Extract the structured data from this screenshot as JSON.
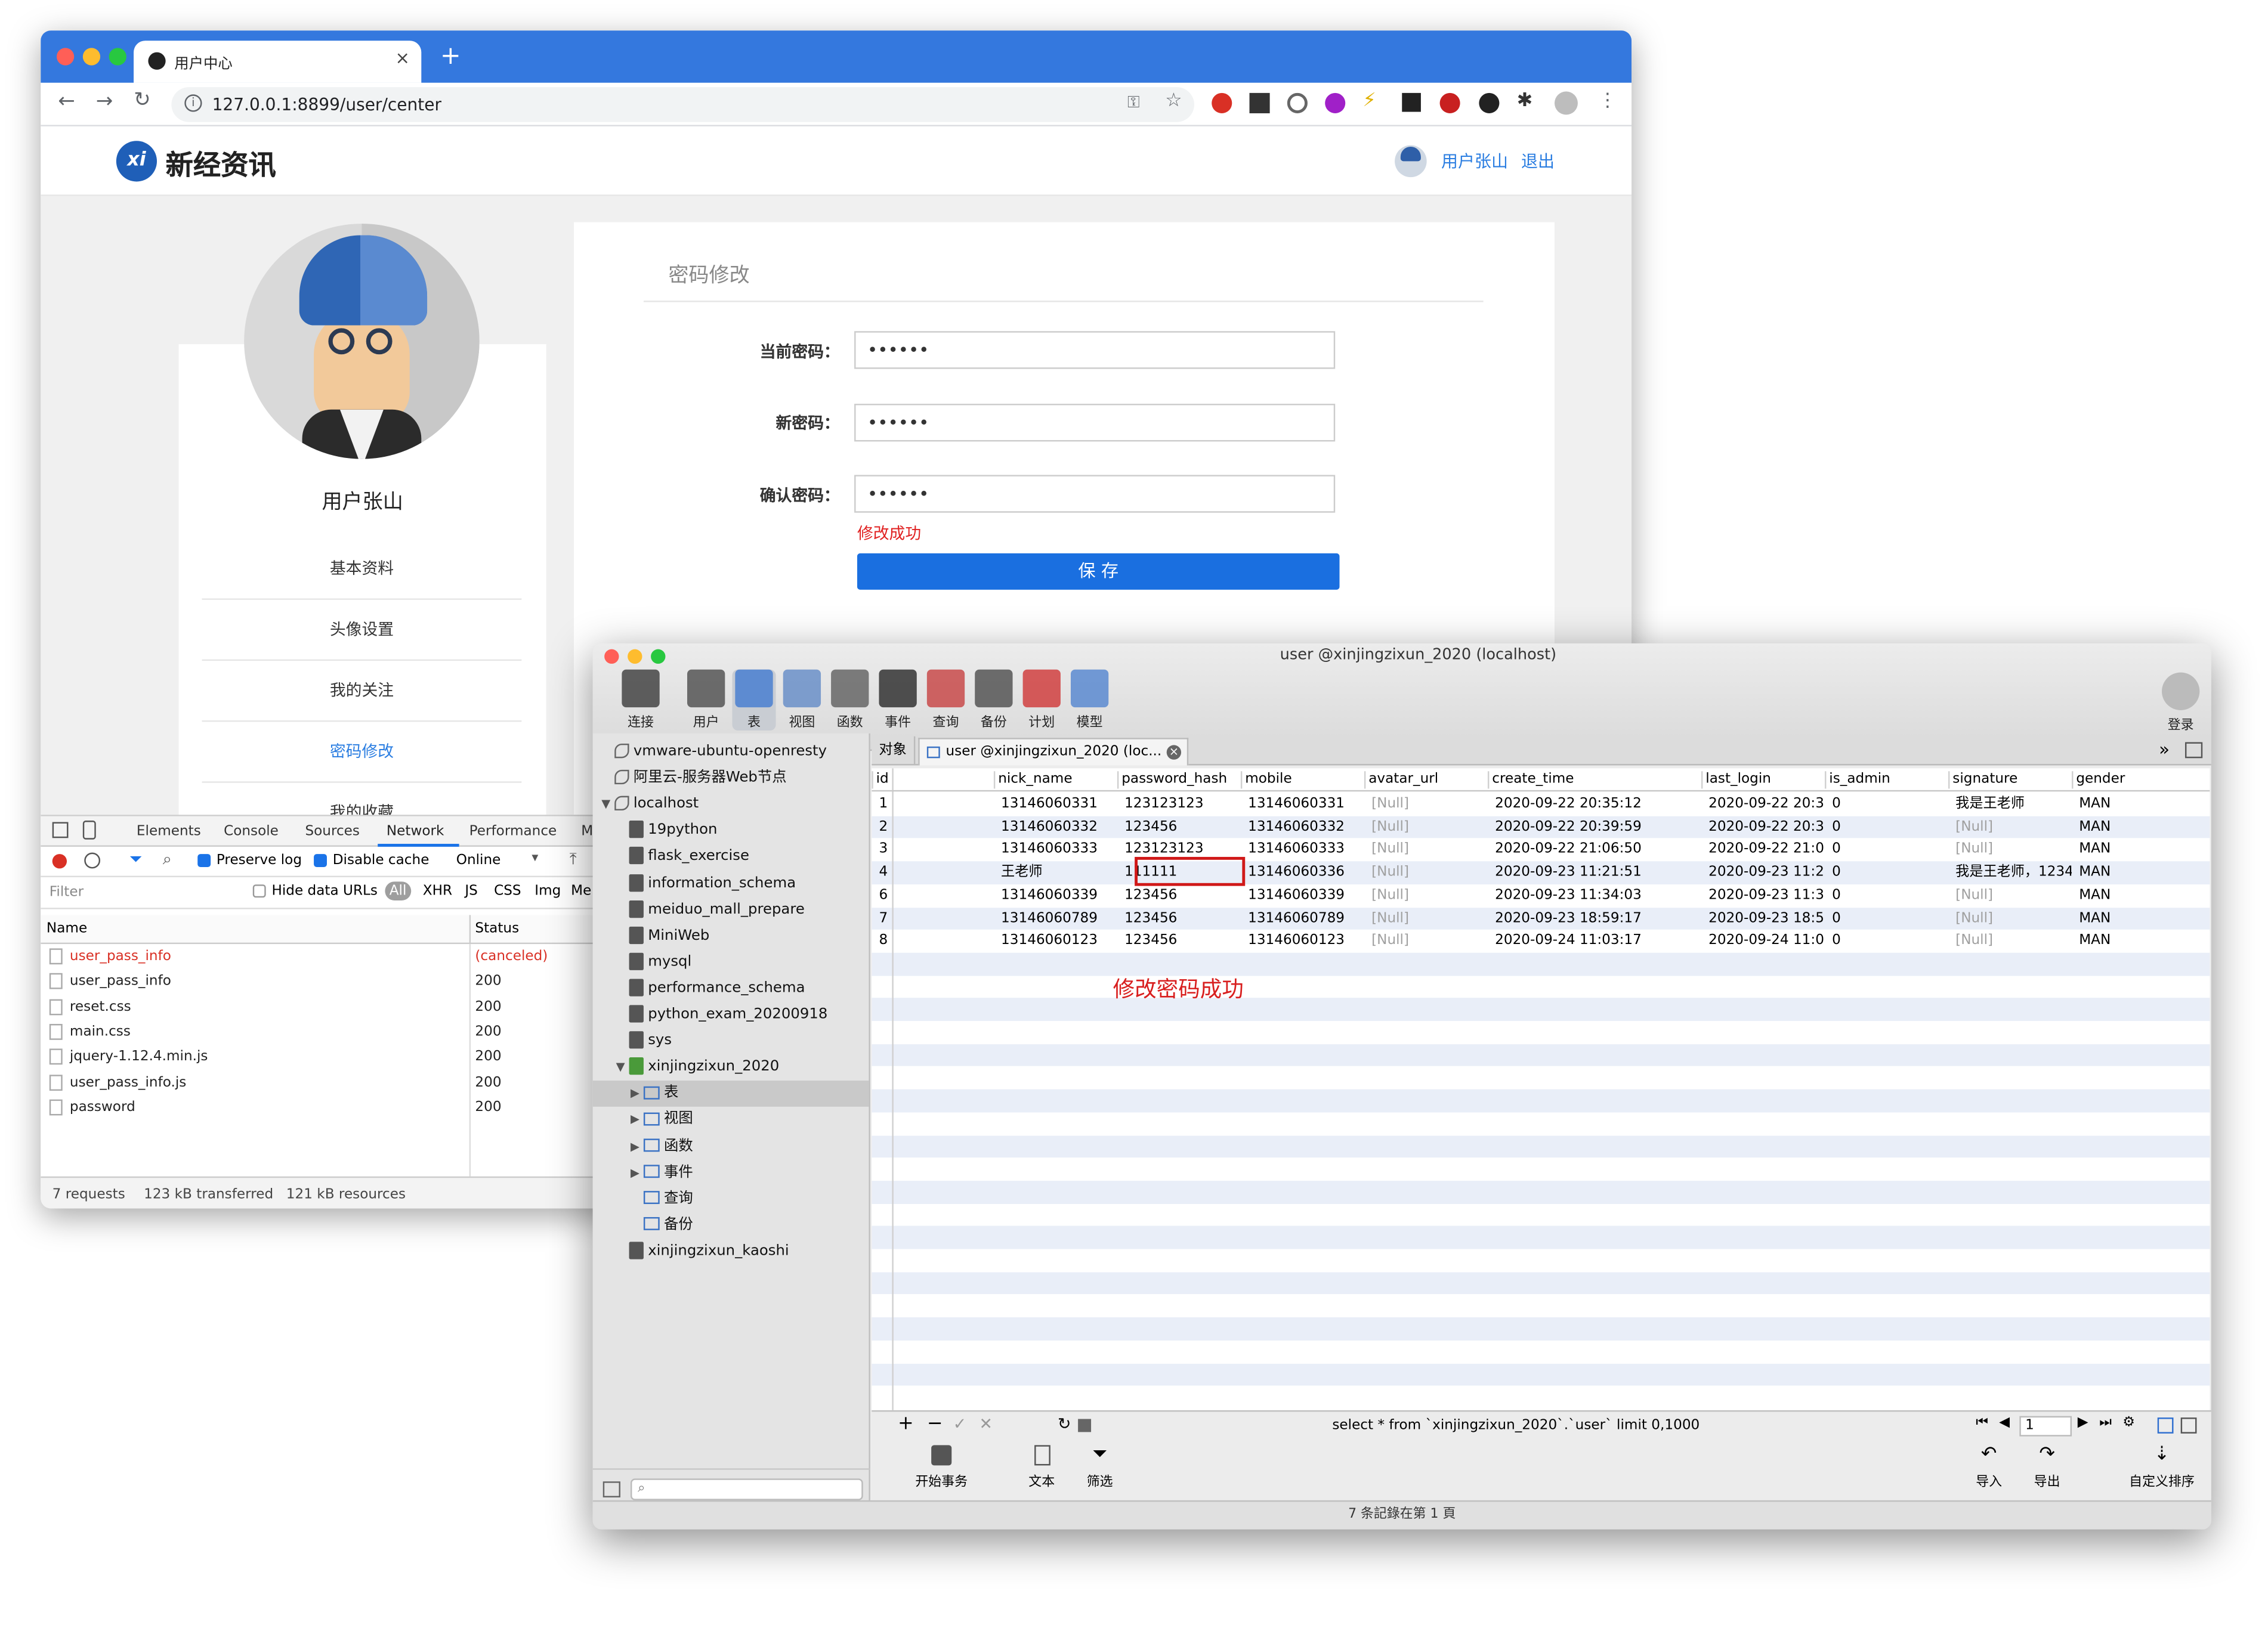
{
  "browser": {
    "tab_title": "用户中心",
    "url": "127.0.0.1:8899/user/center"
  },
  "site": {
    "logo_text": "新经资讯",
    "user_name": "用户张山",
    "logout": "退出",
    "sidebar_name": "用户张山",
    "menu": [
      "基本资料",
      "头像设置",
      "我的关注",
      "密码修改",
      "我的收藏"
    ],
    "active_menu_index": 3,
    "form_title": "密码修改",
    "labels": {
      "current": "当前密码：",
      "new": "新密码：",
      "confirm": "确认密码："
    },
    "values": {
      "current": "••••••",
      "new": "••••••",
      "confirm": "••••••"
    },
    "success_msg": "修改成功",
    "save_button": "保 存"
  },
  "devtools": {
    "tabs": [
      "Elements",
      "Console",
      "Sources",
      "Network",
      "Performance",
      "M"
    ],
    "active_tab": "Network",
    "preserve_log": "Preserve log",
    "disable_cache": "Disable cache",
    "throttle": "Online",
    "filter_placeholder": "Filter",
    "hide_data_urls": "Hide data URLs",
    "types": [
      "All",
      "XHR",
      "JS",
      "CSS",
      "Img",
      "Me"
    ],
    "col_name": "Name",
    "col_status": "Status",
    "requests": [
      {
        "name": "user_pass_info",
        "status": "(canceled)",
        "error": true
      },
      {
        "name": "user_pass_info",
        "status": "200",
        "error": false
      },
      {
        "name": "reset.css",
        "status": "200",
        "error": false
      },
      {
        "name": "main.css",
        "status": "200",
        "error": false
      },
      {
        "name": "jquery-1.12.4.min.js",
        "status": "200",
        "error": false
      },
      {
        "name": "user_pass_info.js",
        "status": "200",
        "error": false
      },
      {
        "name": "password",
        "status": "200",
        "error": false
      }
    ],
    "summary": [
      "7 requests",
      "123 kB transferred",
      "121 kB resources"
    ]
  },
  "navicat": {
    "title": "user @xinjingzixun_2020 (localhost)",
    "toolbar": [
      "连接",
      "用户",
      "表",
      "视图",
      "函数",
      "事件",
      "查询",
      "备份",
      "计划",
      "模型"
    ],
    "login": "登录",
    "sidebar": [
      {
        "label": "vmware-ubuntu-openresty",
        "level": 0,
        "type": "conn"
      },
      {
        "label": "阿里云-服务器Web节点",
        "level": 0,
        "type": "conn"
      },
      {
        "label": "localhost",
        "level": 0,
        "type": "conn-open"
      },
      {
        "label": "19python",
        "level": 1,
        "type": "db"
      },
      {
        "label": "flask_exercise",
        "level": 1,
        "type": "db"
      },
      {
        "label": "information_schema",
        "level": 1,
        "type": "db"
      },
      {
        "label": "meiduo_mall_prepare",
        "level": 1,
        "type": "db"
      },
      {
        "label": "MiniWeb",
        "level": 1,
        "type": "db"
      },
      {
        "label": "mysql",
        "level": 1,
        "type": "db"
      },
      {
        "label": "performance_schema",
        "level": 1,
        "type": "db"
      },
      {
        "label": "python_exam_20200918",
        "level": 1,
        "type": "db"
      },
      {
        "label": "sys",
        "level": 1,
        "type": "db"
      },
      {
        "label": "xinjingzixun_2020",
        "level": 1,
        "type": "db-open"
      },
      {
        "label": "表",
        "level": 2,
        "type": "folder-sel"
      },
      {
        "label": "视图",
        "level": 2,
        "type": "folder"
      },
      {
        "label": "函数",
        "level": 2,
        "type": "folder"
      },
      {
        "label": "事件",
        "level": 2,
        "type": "folder"
      },
      {
        "label": "查询",
        "level": 2,
        "type": "leaf"
      },
      {
        "label": "备份",
        "level": 2,
        "type": "leaf"
      },
      {
        "label": "xinjingzixun_kaoshi",
        "level": 1,
        "type": "db"
      }
    ],
    "object_tab": "对象",
    "table_tab": "user @xinjingzixun_2020 (loc...",
    "columns": [
      "id",
      "nick_name",
      "password_hash",
      "mobile",
      "avatar_url",
      "create_time",
      "last_login",
      "is_admin",
      "signature",
      "gender"
    ],
    "rows": [
      [
        "1",
        "13146060331",
        "123123123",
        "13146060331",
        "[Null]",
        "2020-09-22 20:35:12",
        "2020-09-22 20:3",
        "0",
        "我是王老师",
        "MAN"
      ],
      [
        "2",
        "13146060332",
        "123456",
        "13146060332",
        "[Null]",
        "2020-09-22 20:39:59",
        "2020-09-22 20:3",
        "0",
        "[Null]",
        "MAN"
      ],
      [
        "3",
        "13146060333",
        "123123123",
        "13146060333",
        "[Null]",
        "2020-09-22 21:06:50",
        "2020-09-22 21:0",
        "0",
        "[Null]",
        "MAN"
      ],
      [
        "4",
        "王老师",
        "111111",
        "13146060336",
        "[Null]",
        "2020-09-23 11:21:51",
        "2020-09-23 11:2",
        "0",
        "我是王老师，1234",
        "MAN"
      ],
      [
        "6",
        "13146060339",
        "123456",
        "13146060339",
        "[Null]",
        "2020-09-23 11:34:03",
        "2020-09-23 11:3",
        "0",
        "[Null]",
        "MAN"
      ],
      [
        "7",
        "13146060789",
        "123456",
        "13146060789",
        "[Null]",
        "2020-09-23 18:59:17",
        "2020-09-23 18:5",
        "0",
        "[Null]",
        "MAN"
      ],
      [
        "8",
        "13146060123",
        "123456",
        "13146060123",
        "[Null]",
        "2020-09-24 11:03:17",
        "2020-09-24 11:0",
        "0",
        "[Null]",
        "MAN"
      ]
    ],
    "annotation": "修改密码成功",
    "sql": "select * from `xinjingzixun_2020`.`user`  limit 0,1000",
    "page": "1",
    "footer_buttons": [
      "开始事务",
      "文本",
      "筛选"
    ],
    "footer_right": [
      "导入",
      "导出",
      "自定义排序"
    ],
    "status": "7 条記錄在第 1 頁",
    "colors": {
      "accent": "#3478de",
      "save": "#1a6fe0",
      "error": "#e02020",
      "annotation": "#d81e1e"
    }
  }
}
